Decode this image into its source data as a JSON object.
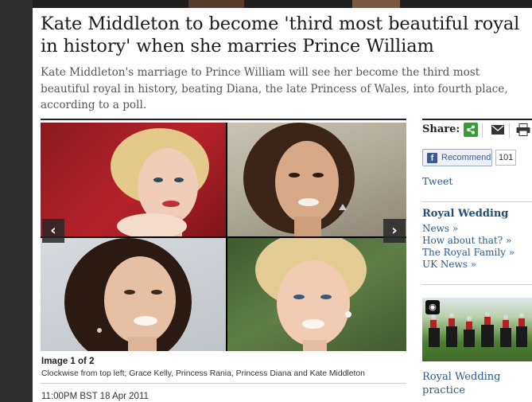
{
  "article": {
    "headline": "Kate Middleton to become 'third most beautiful royal in history' when she marries Prince William",
    "standfirst": "Kate Middleton's marriage to Prince William will see her become the third most beautiful royal in history, beating Diana, the late Princess of Wales, into fourth place, according to a poll.",
    "dateline": "11:00PM BST 18 Apr 2011"
  },
  "gallery": {
    "counter": "Image 1 of 2",
    "caption": "Clockwise from top left; Grace Kelly, Princess Rania, Princess Diana and Kate Middleton",
    "prev_icon": "chevron-left-icon",
    "next_icon": "chevron-right-icon"
  },
  "share": {
    "label": "Share:",
    "icons": [
      "share-icon",
      "email-icon",
      "print-icon"
    ],
    "facebook_label": "Recommend",
    "facebook_count": "101",
    "tweet_label": "Tweet"
  },
  "related": {
    "heading": "Royal Wedding",
    "links": [
      "News »",
      "How about that? »",
      "The Royal Family »",
      "UK News »"
    ]
  },
  "promo": {
    "title": "Royal Wedding practice",
    "icon": "camera-icon"
  },
  "colors": {
    "link": "#2a5a8a",
    "heading_link": "#1f4e79",
    "facebook": "#3b5998",
    "share_green": "#3a9a3a"
  }
}
